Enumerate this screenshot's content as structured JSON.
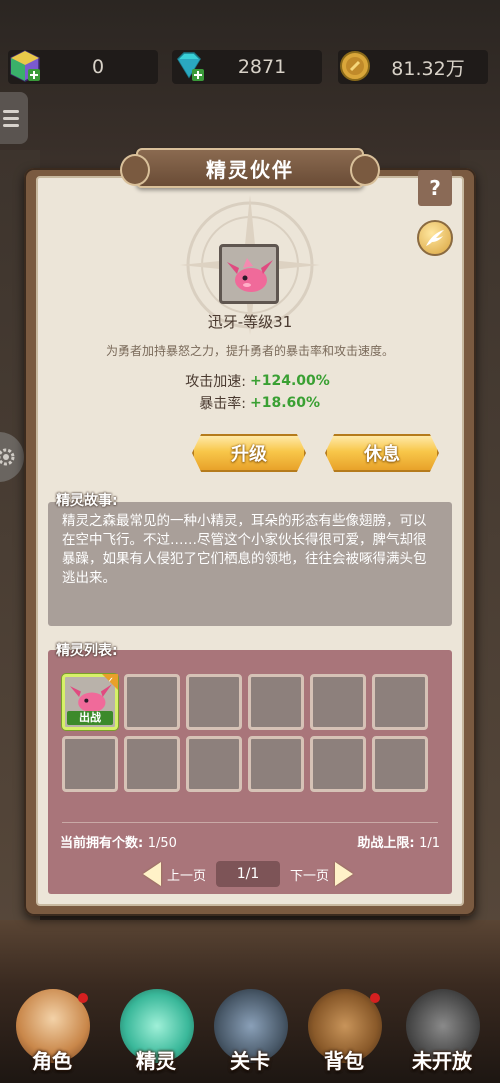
{
  "resources": {
    "gems": "0",
    "diamonds": "2871",
    "gold": "81.32万"
  },
  "panel": {
    "title": "精灵伙伴",
    "help_label": "?"
  },
  "spirit": {
    "name": "迅牙-等级31",
    "description": "为勇者加持暴怒之力，提升勇者的暴击率和攻击速度。",
    "stats": [
      {
        "label": "攻击加速:",
        "value": "+124.00%"
      },
      {
        "label": "暴击率:",
        "value": "+18.60%"
      }
    ]
  },
  "buttons": {
    "upgrade": "升级",
    "rest": "休息"
  },
  "story": {
    "label": "精灵故事:",
    "text": "精灵之森最常见的一种小精灵，耳朵的形态有些像翅膀，可以在空中飞行。不过……尽管这个小家伙长得很可爱，脾气却很暴躁，如果有人侵犯了它们栖息的领地，往往会被啄得满头包逃出来。"
  },
  "list": {
    "label": "精灵列表:",
    "active_badge": "出战",
    "owned_label": "当前拥有个数:",
    "owned_value": "1/50",
    "assist_label": "助战上限:",
    "assist_value": "1/1",
    "prev": "上一页",
    "next": "下一页",
    "page": "1/1"
  },
  "nav": [
    {
      "label": "角色",
      "icon": "hero-icon",
      "dot": true
    },
    {
      "label": "精灵",
      "icon": "spirit-icon",
      "dot": false
    },
    {
      "label": "关卡",
      "icon": "stage-icon",
      "dot": false
    },
    {
      "label": "背包",
      "icon": "backpack-icon",
      "dot": true
    },
    {
      "label": "未开放",
      "icon": "locked-icon",
      "dot": false
    }
  ],
  "colors": {
    "accent_green": "#3aa033",
    "gold_button": "#f8c74a",
    "notify_red": "#d52020"
  }
}
